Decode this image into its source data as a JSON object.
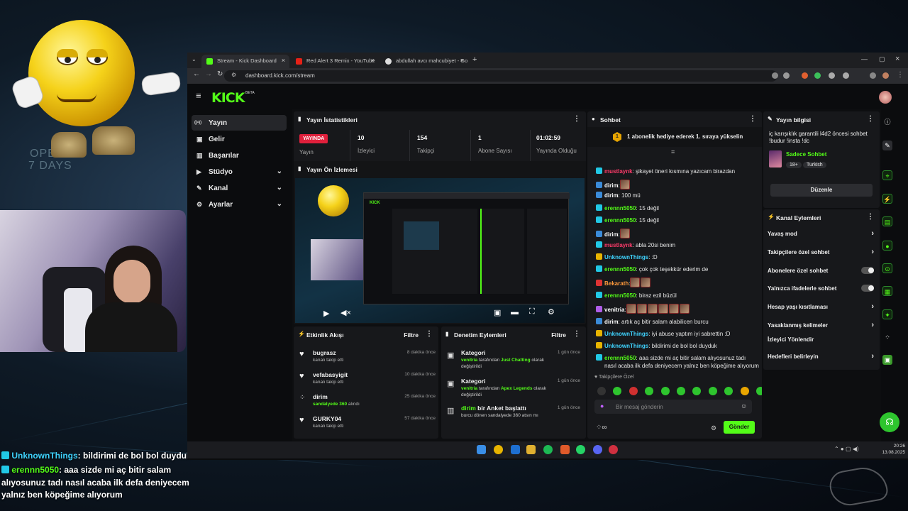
{
  "overlay": {
    "bg_text_1": "OPE",
    "bg_text_2": "7 DAYS",
    "chat": [
      {
        "user": "UnknownThings",
        "text": ": bildirimi de bol bol duyduk"
      },
      {
        "user": "erennn5050",
        "text": ": aaa sizde mi aç bitir salam"
      },
      {
        "user": "",
        "text": "alıyosunuz tadı nasıl acaba ilk defa deniyecem"
      },
      {
        "user": "",
        "text": "yalnız ben köpeğime alıyorum"
      }
    ]
  },
  "browser": {
    "tabs": [
      {
        "label": "Stream - Kick Dashboard",
        "active": true
      },
      {
        "label": "Red Alert 3 Remix - YouTube",
        "active": false
      },
      {
        "label": "abdullah avcı mahcubiyet - Go",
        "active": false
      }
    ],
    "url": "dashboard.kick.com/stream"
  },
  "kick": {
    "logo": "KICK",
    "logo_badge": "BETA",
    "sidebar": [
      {
        "icon": "broadcast-icon",
        "glyph": "((•))",
        "label": "Yayın",
        "active": true,
        "chevron": false
      },
      {
        "icon": "wallet-icon",
        "glyph": "▣",
        "label": "Gelir",
        "active": false,
        "chevron": false
      },
      {
        "icon": "trophy-icon",
        "glyph": "▥",
        "label": "Başarılar",
        "active": false,
        "chevron": false
      },
      {
        "icon": "camera-icon",
        "glyph": "▶",
        "label": "Stüdyo",
        "active": false,
        "chevron": true
      },
      {
        "icon": "channel-icon",
        "glyph": "✎",
        "label": "Kanal",
        "active": false,
        "chevron": true
      },
      {
        "icon": "gear-icon",
        "glyph": "⚙",
        "label": "Ayarlar",
        "active": false,
        "chevron": true
      }
    ],
    "stats": {
      "title": "Yayın İstatistikleri",
      "live_badge": "YAYINDA",
      "items": [
        {
          "value": "",
          "label": "Yayın"
        },
        {
          "value": "10",
          "label": "İzleyici"
        },
        {
          "value": "154",
          "label": "Takipçi"
        },
        {
          "value": "1",
          "label": "Abone Sayısı"
        },
        {
          "value": "01:02:59",
          "label": "Yayında Olduğu"
        }
      ]
    },
    "preview": {
      "title": "Yayın Ön İzlemesi"
    },
    "activity": {
      "title": "Etkinlik Akışı",
      "filter": "Filtre",
      "items": [
        {
          "name": "bugrasz",
          "sub": "kanalı takip etti",
          "time": "8 dakika önce"
        },
        {
          "name": "vefabasyigit",
          "sub": "kanalı takip etti",
          "time": "10 dakika önce"
        },
        {
          "name": "dirim",
          "sub_green": "sandalyede 360",
          "sub": " alındı",
          "time": "25 dakika önce"
        },
        {
          "name": "GURKY04",
          "sub": "kanalı takip etti",
          "time": "57 dakika önce"
        }
      ]
    },
    "moderation": {
      "title": "Denetim Eylemleri",
      "filter": "Filtre",
      "items": [
        {
          "title": "Kategori",
          "user": "venitria",
          "mid": " tarafından ",
          "cat": "Just Chatting",
          "end": " olarak değiştirildi",
          "time": "1 gün önce"
        },
        {
          "title": "Kategori",
          "user": "venitria",
          "mid": " tarafından ",
          "cat": "Apex Legends",
          "end": " olarak değiştirildi",
          "time": "1 gün önce"
        },
        {
          "title_green": "dirim",
          "title": " bir Anket başlattı",
          "line": "burcu dönen sandalyede 360 atsın mı",
          "time": "1 gün önce"
        }
      ]
    },
    "chat": {
      "title": "Sohbet",
      "pinned": "1 abonelik hediye ederek 1. sıraya yükselin",
      "pinned_num": "1",
      "messages": [
        {
          "user": "mustlaynk",
          "color": "#ff3b6a",
          "badge": "#21c8e5",
          "text": ": şikayet öneri kısmına yazıcam birazdan",
          "emotes": 0
        },
        {
          "user": "dirim",
          "color": "#ffffff",
          "badge": "#3b8bd8",
          "text": ":",
          "emotes": 1
        },
        {
          "user": "dirim",
          "color": "#ffffff",
          "badge": "#3b8bd8",
          "text": ": 100 mü",
          "emotes": 0
        },
        {
          "user": "erennn5050",
          "color": "#53fc18",
          "badge": "#21c8e5",
          "text": ": 15 değil",
          "emotes": 0
        },
        {
          "user": "erennn5050",
          "color": "#53fc18",
          "badge": "#21c8e5",
          "text": ": 15 değil",
          "emotes": 0
        },
        {
          "user": "dirim",
          "color": "#ffffff",
          "badge": "#3b8bd8",
          "text": ":",
          "emotes": 1
        },
        {
          "user": "mustlaynk",
          "color": "#ff3b6a",
          "badge": "#21c8e5",
          "text": ": abla 20si benim",
          "emotes": 0
        },
        {
          "user": "UnknownThings",
          "color": "#3fd4ff",
          "badge": "#e8b400",
          "text": ": :D",
          "emotes": 0
        },
        {
          "user": "erennn5050",
          "color": "#53fc18",
          "badge": "#21c8e5",
          "text": ": çok çok teşekkür ederim de",
          "emotes": 0
        },
        {
          "user": "Bekarath",
          "color": "#ff9a3c",
          "badge": "#e03333",
          "text": ":",
          "emotes": 2
        },
        {
          "user": "erennn5050",
          "color": "#53fc18",
          "badge": "#21c8e5",
          "text": ": biraz ezil büzül",
          "emotes": 0
        },
        {
          "user": "venitria",
          "color": "#ffffff",
          "badge": "#b05de8",
          "text": ":",
          "emotes": 6
        },
        {
          "user": "dirim",
          "color": "#ffffff",
          "badge": "#3b8bd8",
          "text": ": artık aç bitir salam alabilicen burcu",
          "emotes": 0
        },
        {
          "user": "UnknownThings",
          "color": "#3fd4ff",
          "badge": "#e8b400",
          "text": ": iyi abuse yaptım iyi sabrettin :D",
          "emotes": 0
        },
        {
          "user": "UnknownThings",
          "color": "#3fd4ff",
          "badge": "#e8b400",
          "text": ": bildirimi de bol bol duyduk",
          "emotes": 0
        },
        {
          "user": "erennn5050",
          "color": "#53fc18",
          "badge": "#21c8e5",
          "text": ": aaa sizde mi aç bitir salam alıyosunuz tadı",
          "emotes": 0
        },
        {
          "user": "",
          "color": "#ffffff",
          "badge": "",
          "text": "nasıl acaba ilk defa deniyecem yalnız ben köpeğime alıyorum",
          "emotes": 0
        }
      ],
      "followers_only": "Takipçilere Özel",
      "input_placeholder": "Bir mesaj gönderin",
      "send": "Gönder"
    },
    "stream_info": {
      "title": "Yayın bilgisi",
      "stream_title": "iç karışıklık garantili l4d2 öncesi sohbet !budur !insta !dc",
      "category": "Sadece Sohbet",
      "tags": [
        "18+",
        "Turkish"
      ],
      "edit": "Düzenle"
    },
    "channel_actions": {
      "title": "Kanal Eylemleri",
      "items": [
        {
          "label": "Yavaş mod",
          "kind": "chevron"
        },
        {
          "label": "Takipçilere özel sohbet",
          "kind": "chevron"
        },
        {
          "label": "Abonelere özel sohbet",
          "kind": "toggle"
        },
        {
          "label": "Yalnızca ifadelerle sohbet",
          "kind": "toggle"
        },
        {
          "label": "Hesap yaşı kısıtlaması",
          "kind": "chevron"
        },
        {
          "label": "Yasaklanmış kelimeler",
          "kind": "chevron"
        },
        {
          "label": "İzleyici Yönlendir",
          "kind": "none"
        },
        {
          "label": "Hedefleri belirleyin",
          "kind": "chevron"
        }
      ]
    }
  },
  "taskbar": {
    "time": "20:26",
    "date": "13.08.2025"
  },
  "colors": {
    "kick_green": "#53fc18",
    "live_red": "#e0203c",
    "panel": "#17181b",
    "background": "#0d0e10"
  }
}
